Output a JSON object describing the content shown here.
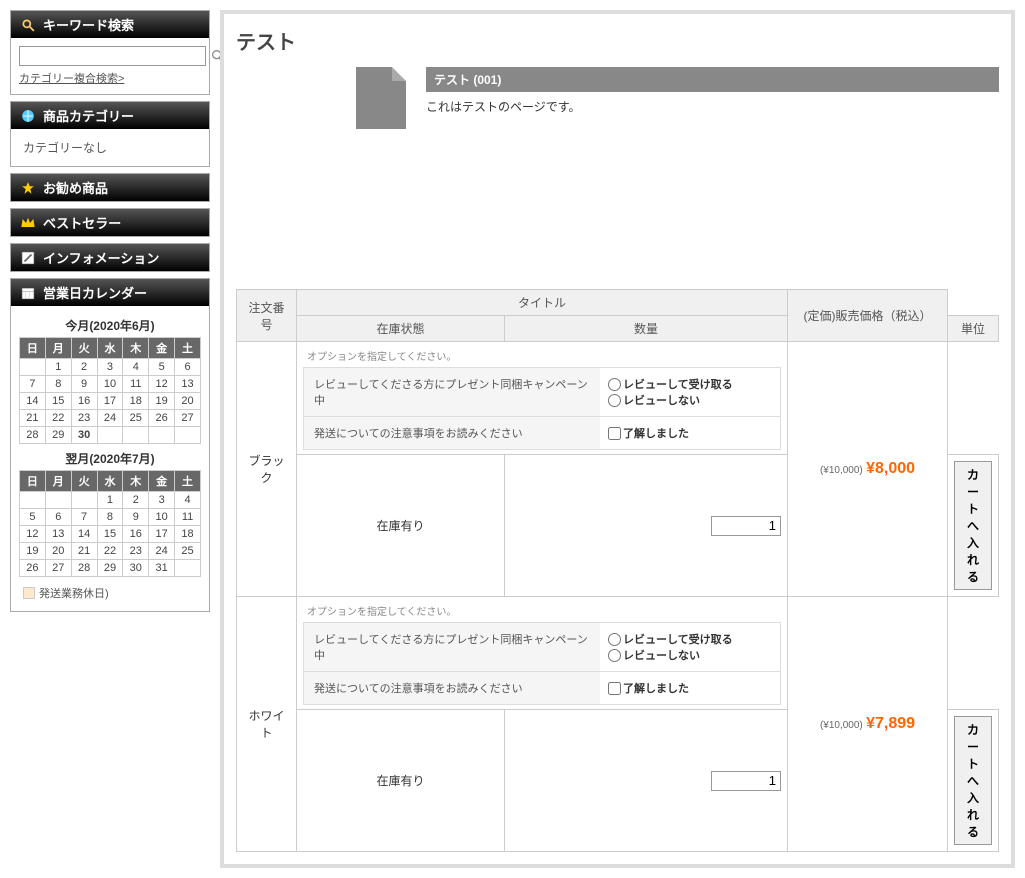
{
  "sidebar": {
    "search": {
      "title": "キーワード検索",
      "placeholder": "",
      "link": "カテゴリー複合検索>"
    },
    "category": {
      "title": "商品カテゴリー",
      "none": "カテゴリーなし"
    },
    "recommend": {
      "title": "お勧め商品"
    },
    "bestseller": {
      "title": "ベストセラー"
    },
    "information": {
      "title": "インフォメーション"
    },
    "calendar": {
      "title": "営業日カレンダー",
      "months": [
        {
          "label": "今月(2020年6月)",
          "dow": [
            "日",
            "月",
            "火",
            "水",
            "木",
            "金",
            "土"
          ],
          "weeks": [
            [
              "",
              "1",
              "2",
              "3",
              "4",
              "5",
              "6"
            ],
            [
              "7",
              "8",
              "9",
              "10",
              "11",
              "12",
              "13"
            ],
            [
              "14",
              "15",
              "16",
              "17",
              "18",
              "19",
              "20"
            ],
            [
              "21",
              "22",
              "23",
              "24",
              "25",
              "26",
              "27"
            ],
            [
              "28",
              "29",
              "30",
              "",
              "",
              "",
              ""
            ]
          ],
          "today": "30"
        },
        {
          "label": "翌月(2020年7月)",
          "dow": [
            "日",
            "月",
            "火",
            "水",
            "木",
            "金",
            "土"
          ],
          "weeks": [
            [
              "",
              "",
              "",
              "1",
              "2",
              "3",
              "4"
            ],
            [
              "5",
              "6",
              "7",
              "8",
              "9",
              "10",
              "11"
            ],
            [
              "12",
              "13",
              "14",
              "15",
              "16",
              "17",
              "18"
            ],
            [
              "19",
              "20",
              "21",
              "22",
              "23",
              "24",
              "25"
            ],
            [
              "26",
              "27",
              "28",
              "29",
              "30",
              "31",
              ""
            ]
          ],
          "today": ""
        }
      ],
      "legend": "発送業務休日)"
    }
  },
  "product": {
    "title": "テスト",
    "name": "テスト (001)",
    "description": "これはテストのページです。"
  },
  "table": {
    "headers": {
      "order_no": "注文番号",
      "title": "タイトル",
      "stock_status": "在庫状態",
      "quantity": "数量",
      "price": "(定価)販売価格（税込）",
      "unit": "単位"
    },
    "option_note": "オプションを指定してください。",
    "campaign_label": "レビューしてくださる方にプレゼント同梱キャンペーン中",
    "review_yes": "レビューして受け取る",
    "review_no": "レビューしない",
    "notice_label": "発送についての注意事項をお読みください",
    "notice_check": "了解しました",
    "stock_ok": "在庫有り",
    "cart_button": "カートへ入れる",
    "variants": [
      {
        "name": "ブラック",
        "list_price": "(¥10,000)",
        "sale_price": "¥8,000",
        "qty": "1"
      },
      {
        "name": "ホワイト",
        "list_price": "(¥10,000)",
        "sale_price": "¥7,899",
        "qty": "1"
      }
    ]
  }
}
